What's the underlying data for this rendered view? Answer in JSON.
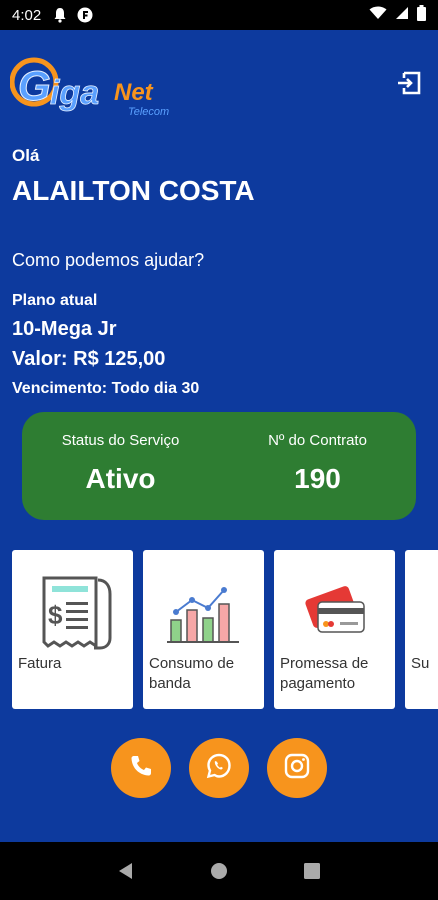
{
  "status_bar": {
    "time": "4:02",
    "icons": [
      "notification-bell-icon",
      "app-notification-icon",
      "wifi-icon",
      "signal-icon",
      "battery-icon"
    ]
  },
  "header": {
    "logo_text": "GigaNet",
    "logo_subtext": "Telecom",
    "logout_icon": "logout-icon"
  },
  "user": {
    "greeting": "Olá",
    "name": "ALAILTON COSTA",
    "help_text": "Como podemos ajudar?"
  },
  "plan": {
    "label": "Plano atual",
    "name": "10-Mega Jr",
    "value": "Valor: R$ 125,00",
    "due": "Vencimento: Todo dia 30"
  },
  "status_card": {
    "service_label": "Status do Serviço",
    "service_value": "Ativo",
    "contract_label": "Nº do Contrato",
    "contract_value": "190"
  },
  "tiles": [
    {
      "label": "Fatura",
      "icon": "invoice-icon"
    },
    {
      "label": "Consumo de banda",
      "icon": "bandwidth-chart-icon"
    },
    {
      "label": "Promessa de pagamento",
      "icon": "credit-card-icon"
    },
    {
      "label": "Su",
      "icon": "support-icon"
    }
  ],
  "social": [
    {
      "icon": "phone-icon"
    },
    {
      "icon": "whatsapp-icon"
    },
    {
      "icon": "instagram-icon"
    }
  ],
  "nav": {
    "icons": [
      "back-icon",
      "home-icon",
      "recents-icon"
    ]
  },
  "colors": {
    "background": "#0d3a9e",
    "status_card": "#2e7d32",
    "accent": "#f7941d"
  }
}
